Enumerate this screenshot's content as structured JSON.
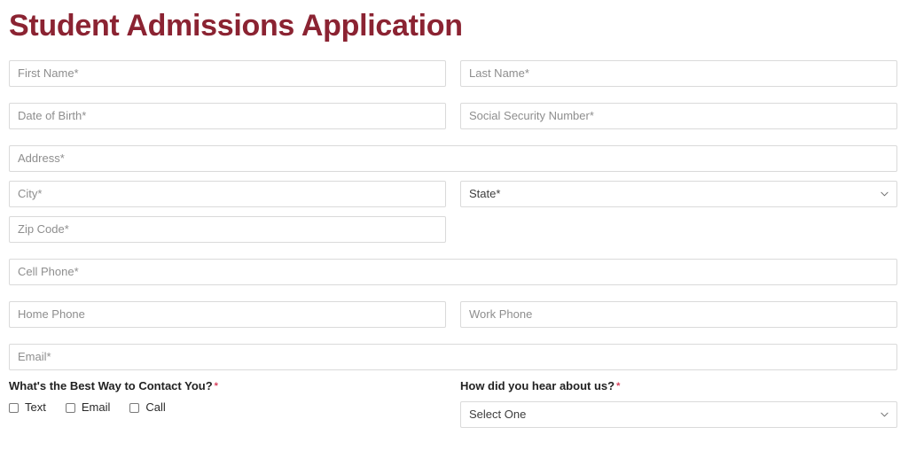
{
  "page": {
    "title": "Student Admissions Application",
    "title_color": "#8b2332",
    "required_marker_color": "#d8405c",
    "field_border_color": "#dadada",
    "placeholder_color": "#8e8e8e"
  },
  "form": {
    "fields": {
      "first_name": {
        "placeholder": "First Name*",
        "value": ""
      },
      "last_name": {
        "placeholder": "Last Name*",
        "value": ""
      },
      "date_of_birth": {
        "placeholder": "Date of Birth*",
        "value": ""
      },
      "social_security_number": {
        "placeholder": "Social Security Number*",
        "value": ""
      },
      "address": {
        "placeholder": "Address*",
        "value": ""
      },
      "city": {
        "placeholder": "City*",
        "value": ""
      },
      "state": {
        "selected": "State*"
      },
      "zip_code": {
        "placeholder": "Zip Code*",
        "value": ""
      },
      "cell_phone": {
        "placeholder": "Cell Phone*",
        "value": ""
      },
      "home_phone": {
        "placeholder": "Home Phone",
        "value": ""
      },
      "work_phone": {
        "placeholder": "Work Phone",
        "value": ""
      },
      "email": {
        "placeholder": "Email*",
        "value": ""
      }
    },
    "contact_preference": {
      "label": "What's the Best Way to Contact You?",
      "required_marker": "*",
      "options": [
        {
          "label": "Text",
          "checked": false
        },
        {
          "label": "Email",
          "checked": false
        },
        {
          "label": "Call",
          "checked": false
        }
      ]
    },
    "referral_source": {
      "label": "How did you hear about us?",
      "required_marker": "*",
      "selected": "Select One"
    }
  }
}
